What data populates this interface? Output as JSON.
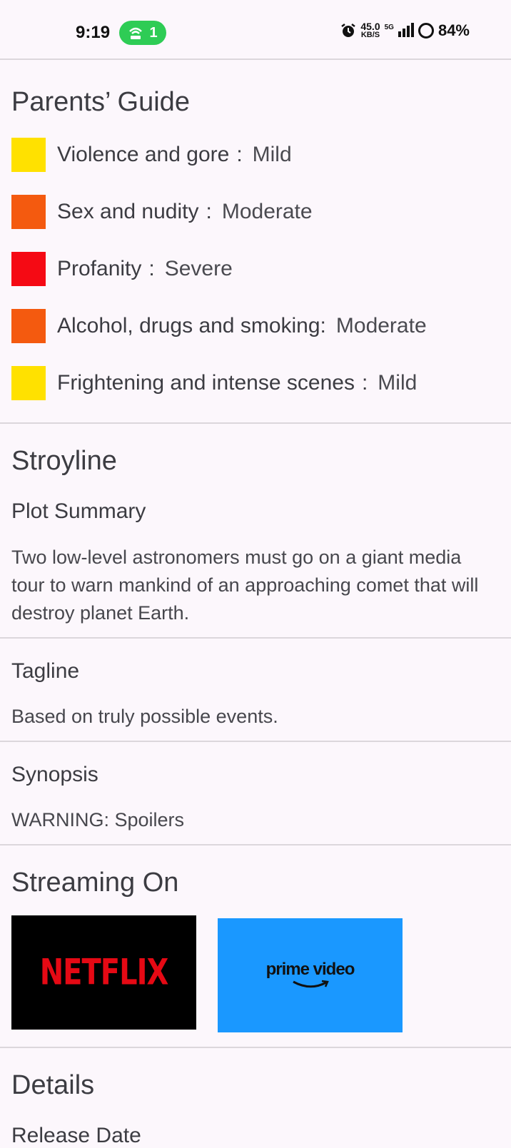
{
  "status_bar": {
    "time": "9:19",
    "hotspot_count": "1",
    "net_speed_value": "45.0",
    "net_speed_unit": "KB/S",
    "network_type": "5G",
    "battery": "84%"
  },
  "parents_guide": {
    "title": "Parents’ Guide",
    "items": [
      {
        "category": "Violence and gore",
        "sep": ":",
        "level": "Mild",
        "color": "#ffe100"
      },
      {
        "category": "Sex and nudity",
        "sep": ":",
        "level": "Moderate",
        "color": "#f45a0f"
      },
      {
        "category": "Profanity",
        "sep": ":",
        "level": "Severe",
        "color": "#f50a14"
      },
      {
        "category": "Alcohol, drugs and smoking",
        "sep": ":",
        "level": "Moderate",
        "color": "#f45a0f"
      },
      {
        "category": "Frightening and intense scenes",
        "sep": ":",
        "level": "Mild",
        "color": "#ffe100"
      }
    ]
  },
  "storyline": {
    "title": "Stroyline",
    "plot_summary_label": "Plot Summary",
    "plot_summary": "Two low-level astronomers must go on a giant media tour to warn mankind of an approaching comet that will destroy planet Earth.",
    "tagline_label": "Tagline",
    "tagline": "Based on truly possible events.",
    "synopsis_label": "Synopsis",
    "synopsis": "WARNING: Spoilers"
  },
  "streaming": {
    "title": "Streaming On",
    "providers": [
      {
        "name": "NETFLIX",
        "bg": "#000000",
        "fg": "#e50914"
      },
      {
        "name": "prime video",
        "bg": "#1a98ff",
        "fg": "#111111"
      }
    ]
  },
  "details": {
    "title": "Details",
    "release_date_label": "Release Date"
  }
}
